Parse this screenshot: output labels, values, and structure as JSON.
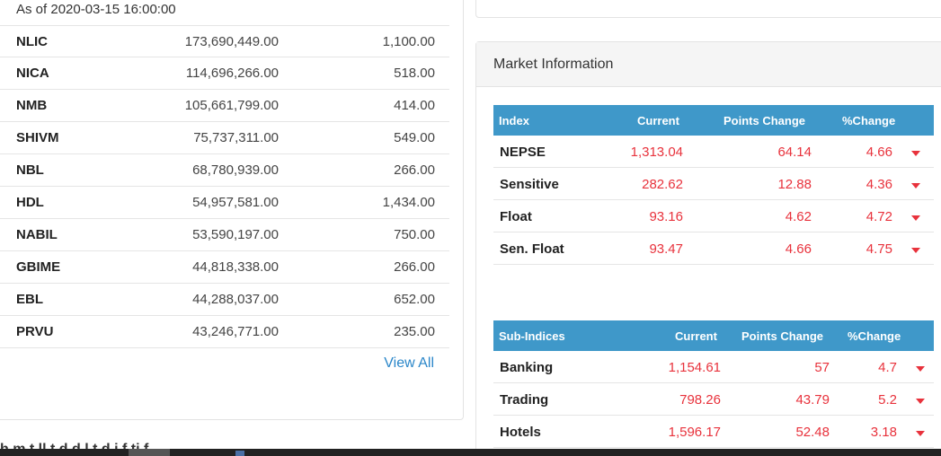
{
  "turnover": {
    "as_of": "As of 2020-03-15 16:00:00",
    "rows": [
      {
        "symbol": "NLIC",
        "amount": "173,690,449.00",
        "ltp": "1,100.00"
      },
      {
        "symbol": "NICA",
        "amount": "114,696,266.00",
        "ltp": "518.00"
      },
      {
        "symbol": "NMB",
        "amount": "105,661,799.00",
        "ltp": "414.00"
      },
      {
        "symbol": "SHIVM",
        "amount": "75,737,311.00",
        "ltp": "549.00"
      },
      {
        "symbol": "NBL",
        "amount": "68,780,939.00",
        "ltp": "266.00"
      },
      {
        "symbol": "HDL",
        "amount": "54,957,581.00",
        "ltp": "1,434.00"
      },
      {
        "symbol": "NABIL",
        "amount": "53,590,197.00",
        "ltp": "750.00"
      },
      {
        "symbol": "GBIME",
        "amount": "44,818,338.00",
        "ltp": "266.00"
      },
      {
        "symbol": "EBL",
        "amount": "44,288,037.00",
        "ltp": "652.00"
      },
      {
        "symbol": "PRVU",
        "amount": "43,246,771.00",
        "ltp": "235.00"
      }
    ],
    "view_all": "View All"
  },
  "market": {
    "title": "Market Information",
    "index_table": {
      "headers": [
        "Index",
        "Current",
        "Points Change",
        "%Change"
      ],
      "rows": [
        {
          "name": "NEPSE",
          "current": "1,313.04",
          "points": "64.14",
          "pct": "4.66"
        },
        {
          "name": "Sensitive",
          "current": "282.62",
          "points": "12.88",
          "pct": "4.36"
        },
        {
          "name": "Float",
          "current": "93.16",
          "points": "4.62",
          "pct": "4.72"
        },
        {
          "name": "Sen. Float",
          "current": "93.47",
          "points": "4.66",
          "pct": "4.75"
        }
      ]
    },
    "sub_table": {
      "headers": [
        "Sub-Indices",
        "Current",
        "Points Change",
        "%Change"
      ],
      "rows": [
        {
          "name": "Banking",
          "current": "1,154.61",
          "points": "57",
          "pct": "4.7"
        },
        {
          "name": "Trading",
          "current": "798.26",
          "points": "43.79",
          "pct": "5.2"
        },
        {
          "name": "Hotels",
          "current": "1,596.17",
          "points": "52.48",
          "pct": "3.18"
        }
      ]
    },
    "colors": {
      "header_blue": "#3f98c9",
      "down_red": "#e8323c",
      "link_blue": "#2a86c9"
    }
  },
  "footer": {
    "cut_text": "h m t ll t d d l t d i f ti f"
  }
}
